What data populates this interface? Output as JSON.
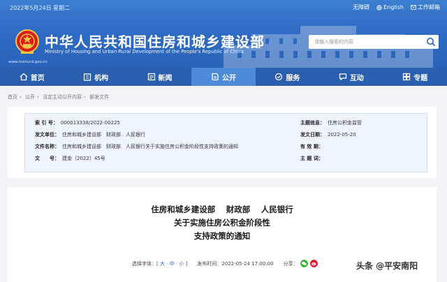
{
  "topbar": {
    "date": "2022年5月24日 星期二",
    "accessibility": "无障碍",
    "english": "English",
    "work_mobile": "工作邮箱"
  },
  "header": {
    "title": "中华人民共和国住房和城乡建设部",
    "subtitle": "Ministry of Housing and Urban-Rural Development of the People's Republic of China",
    "domain": "www.mohurd.gov.cn"
  },
  "search": {
    "placeholder": "请输入搜索的内容"
  },
  "nav": {
    "items": [
      {
        "label": "首页"
      },
      {
        "label": "机构"
      },
      {
        "label": "新闻"
      },
      {
        "label": "公开"
      },
      {
        "label": "服务"
      },
      {
        "label": "互动"
      },
      {
        "label": "专题"
      }
    ]
  },
  "breadcrumb": [
    "首页",
    "公开",
    "法定主动公开内容",
    "部发文件"
  ],
  "info": {
    "index_no_label": "索  引  号：",
    "index_no": "000013338/2022-00225",
    "issuer_label": "发文单位：",
    "issuer": "住房和城乡建设部　财政部　人民银行",
    "title_label": "文件名称：",
    "title": "住房和城乡建设部　财政部　人民银行关于实施住房公积金阶段性支持政策的通知",
    "doc_no_label": "文　　号：",
    "doc_no": "建金〔2022〕45号",
    "topic_label": "主题信息：",
    "topic": "住房公积金监管",
    "date_label": "发文日期：",
    "date": "2022-05-20",
    "validity_label": "有  效  期：",
    "validity": "",
    "subject_label": "主  题  词：",
    "subject": ""
  },
  "article": {
    "line1": "住房和城乡建设部　 财政部　 人民银行",
    "line2": "关于实施住房公积金阶段性",
    "line3": "支持政策的通知",
    "font_label": "选择字体：",
    "font_sizes": "[ 大 · 中 · 小 ]",
    "publish_label": "发布时间：",
    "publish_time": "2022-05-24 17:00:00",
    "share_label": "分享："
  },
  "watermark": "头条 @平安南阳",
  "colors": {
    "header_blue": "#2f6cc4",
    "nav_blue": "#2a5fb0",
    "nav_active": "#4d8ad8",
    "info_bg": "#eef5fe"
  }
}
